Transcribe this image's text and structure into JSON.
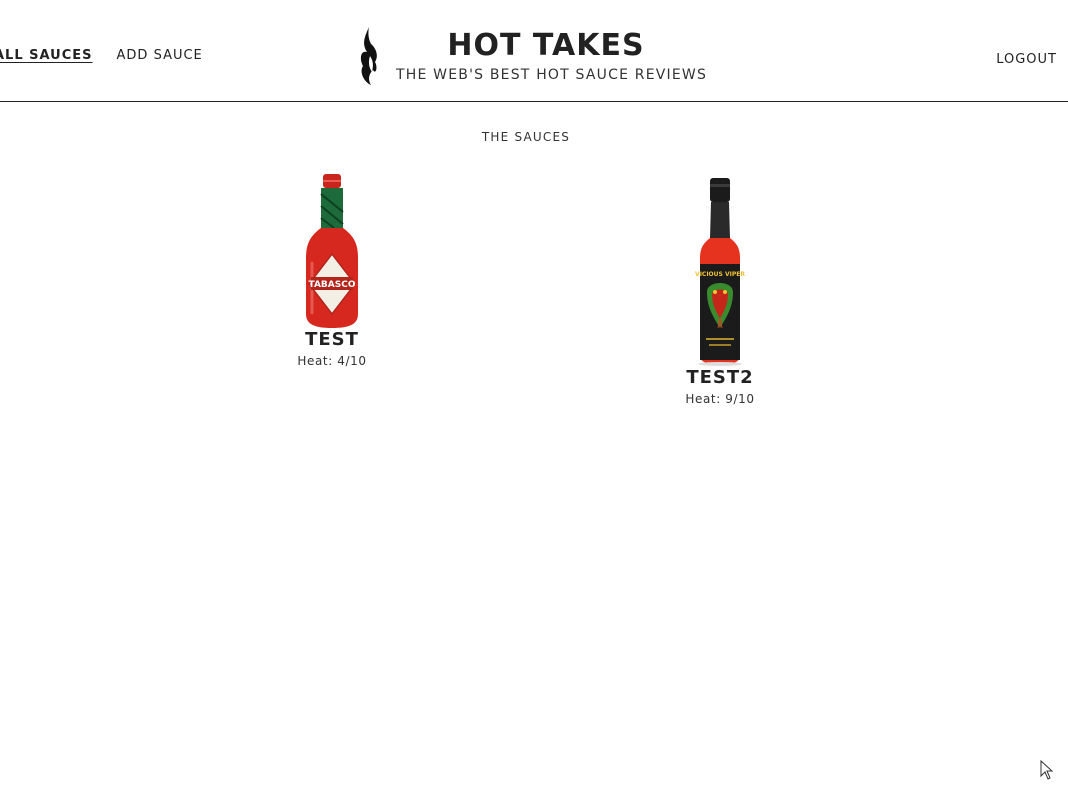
{
  "nav": {
    "all_sauces": "ALL SAUCES",
    "add_sauce": "ADD SAUCE",
    "logout": "LOGOUT"
  },
  "brand": {
    "title": "HOT TAKES",
    "subtitle": "THE WEB'S BEST HOT SAUCE REVIEWS",
    "logo_icon": "flame-icon"
  },
  "main": {
    "section_title": "THE SAUCES",
    "sauces": [
      {
        "name": "TEST",
        "heat": "Heat: 4/10",
        "bottle_label": "TABASCO",
        "image": "tabasco-bottle"
      },
      {
        "name": "TEST2",
        "heat": "Heat: 9/10",
        "bottle_label": "VICIOUS VIPER",
        "image": "vicious-viper-bottle"
      }
    ]
  },
  "colors": {
    "text": "#222222",
    "divider": "#222222",
    "tabasco_red": "#d6281f",
    "tabasco_green": "#1d6b3a",
    "viper_black": "#1b1b1b",
    "viper_green": "#3a8a2e"
  }
}
